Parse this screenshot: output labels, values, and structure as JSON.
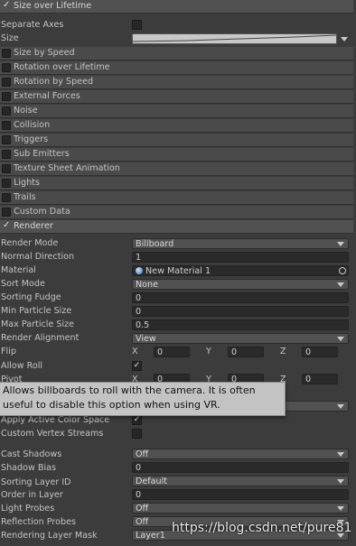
{
  "modules": {
    "size_over_lifetime": "Size over Lifetime",
    "size_by_speed": "Size by Speed",
    "rotation_over_lifetime": "Rotation over Lifetime",
    "rotation_by_speed": "Rotation by Speed",
    "external_forces": "External Forces",
    "noise": "Noise",
    "collision": "Collision",
    "triggers": "Triggers",
    "sub_emitters": "Sub Emitters",
    "texture_sheet_animation": "Texture Sheet Animation",
    "lights": "Lights",
    "trails": "Trails",
    "custom_data": "Custom Data",
    "renderer": "Renderer"
  },
  "size_over_lifetime": {
    "separate_axes_label": "Separate Axes",
    "size_label": "Size"
  },
  "renderer": {
    "render_mode": {
      "label": "Render Mode",
      "value": "Billboard"
    },
    "normal_direction": {
      "label": "Normal Direction",
      "value": "1"
    },
    "material": {
      "label": "Material",
      "value": "New Material 1"
    },
    "sort_mode": {
      "label": "Sort Mode",
      "value": "None"
    },
    "sorting_fudge": {
      "label": "Sorting Fudge",
      "value": "0"
    },
    "min_particle_size": {
      "label": "Min Particle Size",
      "value": "0"
    },
    "max_particle_size": {
      "label": "Max Particle Size",
      "value": "0.5"
    },
    "render_alignment": {
      "label": "Render Alignment",
      "value": "View"
    },
    "flip": {
      "label": "Flip",
      "x": "0",
      "y": "0",
      "z": "0"
    },
    "allow_roll": {
      "label": "Allow Roll"
    },
    "pivot": {
      "label": "Pivot",
      "x": "0",
      "y": "0",
      "z": "0"
    },
    "apply_active_color_space": {
      "label": "Apply Active Color Space"
    },
    "custom_vertex_streams": {
      "label": "Custom Vertex Streams"
    },
    "cast_shadows": {
      "label": "Cast Shadows",
      "value": "Off"
    },
    "shadow_bias": {
      "label": "Shadow Bias",
      "value": "0"
    },
    "sorting_layer_id": {
      "label": "Sorting Layer ID",
      "value": "Default"
    },
    "order_in_layer": {
      "label": "Order in Layer",
      "value": "0"
    },
    "light_probes": {
      "label": "Light Probes",
      "value": "Off"
    },
    "reflection_probes": {
      "label": "Reflection Probes",
      "value": "Off"
    },
    "rendering_layer_mask": {
      "label": "Rendering Layer Mask",
      "value": "Layer1"
    }
  },
  "axis_labels": {
    "x": "X",
    "y": "Y",
    "z": "Z"
  },
  "tooltip": {
    "line1": "Allows billboards to roll with the camera. It is often",
    "line2": "useful to disable this option when using VR."
  },
  "watermark": "https://blog.csdn.net/pure81",
  "icons": {
    "check": "check-icon",
    "dropdown": "chevron-down-icon",
    "target": "object-picker-icon",
    "material": "material-sphere-icon"
  }
}
